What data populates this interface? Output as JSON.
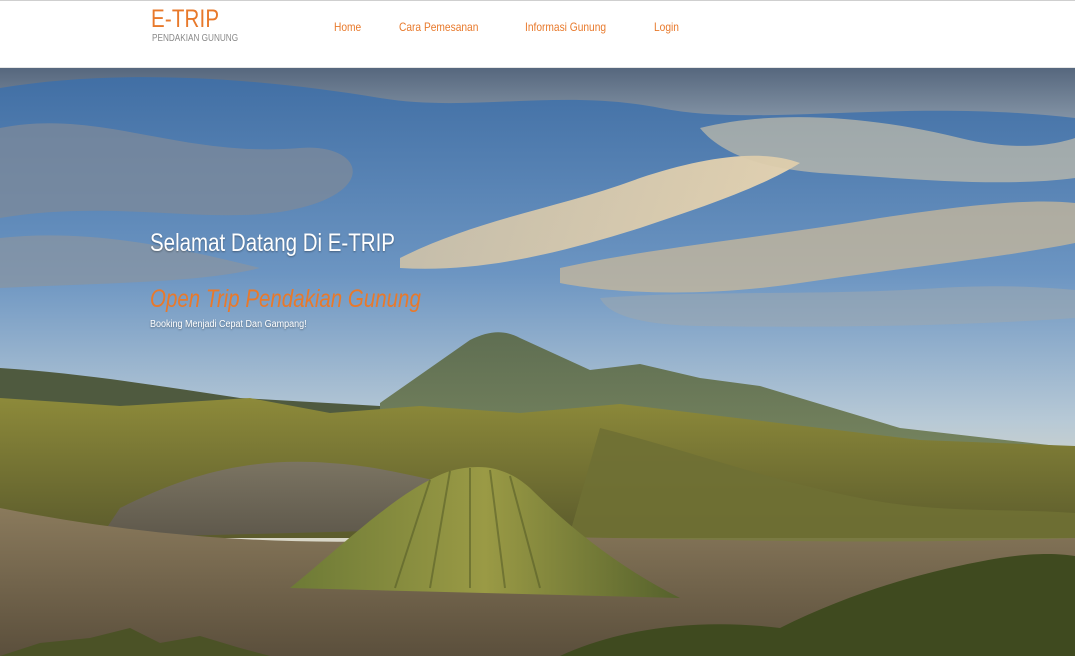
{
  "brand": {
    "title": "E-TRIP",
    "subtitle": "PENDAKIAN GUNUNG"
  },
  "nav": {
    "items": [
      {
        "label": "Home"
      },
      {
        "label": "Cara Pemesanan"
      },
      {
        "label": "Informasi Gunung"
      },
      {
        "label": "Login"
      }
    ]
  },
  "hero": {
    "heading": "Selamat Datang Di E-TRIP",
    "tagline": "Open Trip Pendakian Gunung",
    "subtext": "Booking Menjadi Cepat Dan Gampang!",
    "image": "mountain-landscape-photo"
  },
  "colors": {
    "accent": "#e8792b",
    "nav_bg": "#ffffff",
    "hero_text": "#ffffff",
    "brand_sub": "#8a8a8a"
  }
}
